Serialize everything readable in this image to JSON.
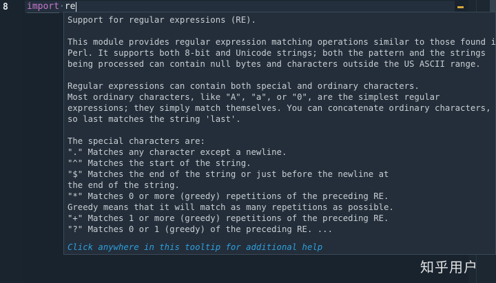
{
  "editor": {
    "line_number": "8",
    "code": {
      "keyword": "import",
      "separator": "·",
      "module": "re"
    }
  },
  "tooltip": {
    "lines": [
      "Support for regular expressions (RE).",
      "",
      "This module provides regular expression matching operations similar to those found in",
      "Perl. It supports both 8-bit and Unicode strings; both the pattern and the strings",
      "being processed can contain null bytes and characters outside the US ASCII range.",
      "",
      "Regular expressions can contain both special and ordinary characters.",
      "Most ordinary characters, like \"A\", \"a\", or \"0\", are the simplest regular",
      "expressions; they simply match themselves. You can concatenate ordinary characters,",
      "so last matches the string 'last'.",
      "",
      "The special characters are:",
      "\".\" Matches any character except a newline.",
      "\"^\" Matches the start of the string.",
      "\"$\" Matches the end of the string or just before the newline at",
      "the end of the string.",
      "\"*\" Matches 0 or more (greedy) repetitions of the preceding RE.",
      "Greedy means that it will match as many repetitions as possible.",
      "\"+\" Matches 1 or more (greedy) repetitions of the preceding RE.",
      "\"?\" Matches 0 or 1 (greedy) of the preceding RE. ..."
    ],
    "help_link": "Click anywhere in this tooltip for additional help"
  },
  "watermark": "知乎用户",
  "colors": {
    "background": "#19232d",
    "tooltip_bg": "#232e3a",
    "keyword": "#c878d0",
    "link": "#2f9edc",
    "warning": "#d8a83a"
  }
}
